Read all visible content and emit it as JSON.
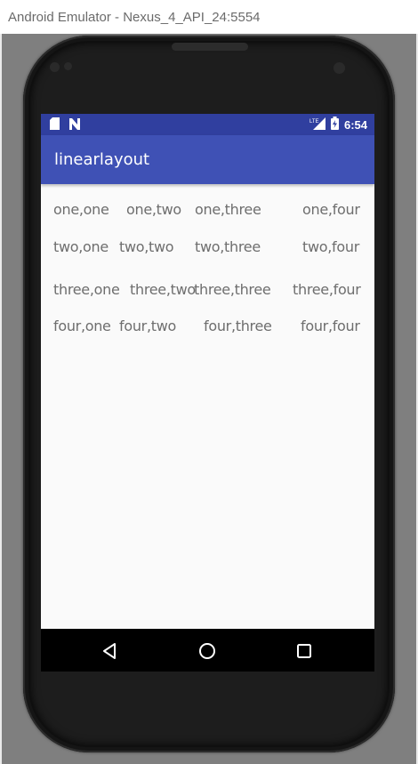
{
  "window": {
    "title": "Android Emulator - Nexus_4_API_24:5554"
  },
  "status_bar": {
    "time": "6:54",
    "network_label": "LTE",
    "icons": [
      "sd-card-icon",
      "notification-n-icon",
      "lte-signal-icon",
      "battery-charging-icon"
    ]
  },
  "app_bar": {
    "title": "linearlayout"
  },
  "grid": {
    "rows": [
      [
        "one,one",
        "one,two",
        "one,three",
        "one,four"
      ],
      [
        "two,one",
        "two,two",
        "two,three",
        "two,four"
      ],
      [
        "three,one",
        "three,two",
        "three,three",
        "three,four"
      ],
      [
        "four,one",
        "four,two",
        "four,three",
        "four,four"
      ]
    ]
  },
  "nav_bar": {
    "buttons": [
      "back-icon",
      "home-icon",
      "recents-icon"
    ]
  },
  "colors": {
    "status_bar": "#303f9f",
    "app_bar": "#3f51b5",
    "screen_bg": "#fafafa",
    "text": "#6e6e6e"
  }
}
